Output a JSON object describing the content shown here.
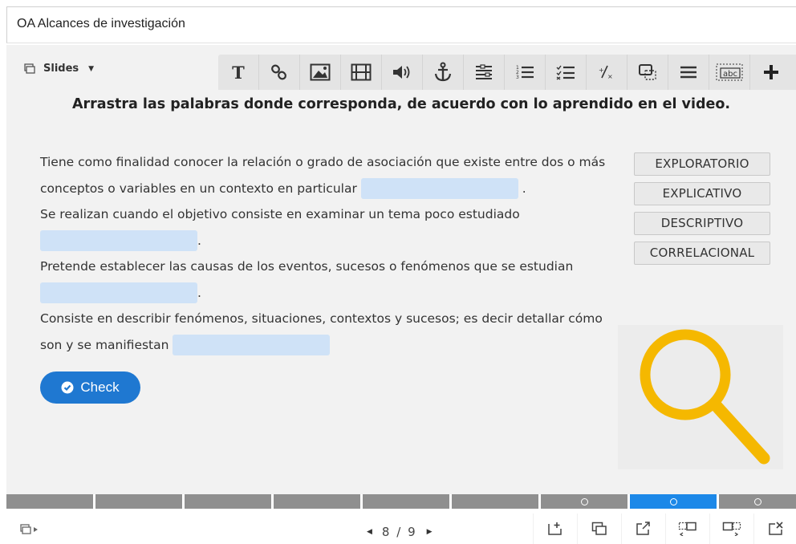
{
  "window": {
    "title": "OA Alcances de investigación"
  },
  "slides_menu": {
    "label": "Slides"
  },
  "toolbar": {
    "tools": [
      "text-icon",
      "link-icon",
      "image-icon",
      "video-icon",
      "audio-icon",
      "anchor-icon",
      "form-icon",
      "ordered-list-icon",
      "checklist-icon",
      "fraction-icon",
      "selection-icon",
      "list-icon",
      "fill-blank-icon",
      "plus-icon"
    ]
  },
  "activity": {
    "instruction": "Arrastra las palabras donde corresponda, de acuerdo con lo aprendido en el video.",
    "statements": [
      {
        "text": "Tiene como finalidad conocer la relación o grado de asociación que existe entre dos o más conceptos o variables en un contexto en particular",
        "suffix": "."
      },
      {
        "text": "Se realizan cuando el objetivo consiste en examinar un tema poco estudiado",
        "suffix": "."
      },
      {
        "text": "Pretende establecer las causas de los eventos, sucesos o fenómenos que se estudian",
        "suffix": "."
      },
      {
        "text": "Consiste en describir fenómenos, situaciones, contextos y sucesos; es decir detallar cómo son y se manifiestan",
        "suffix": ""
      }
    ],
    "word_bank": [
      "EXPLORATORIO",
      "EXPLICATIVO",
      "DESCRIPTIVO",
      "CORRELACIONAL"
    ],
    "check_label": "Check"
  },
  "navigation": {
    "current_page": "8",
    "separator": "/",
    "total_pages": "9",
    "active_segment": 7
  },
  "colors": {
    "accent": "#1f78d1",
    "blank": "#cfe2f7",
    "magnifier": "#f5b800",
    "segment": "#8f8f8f",
    "segment_active": "#1c88e8"
  }
}
